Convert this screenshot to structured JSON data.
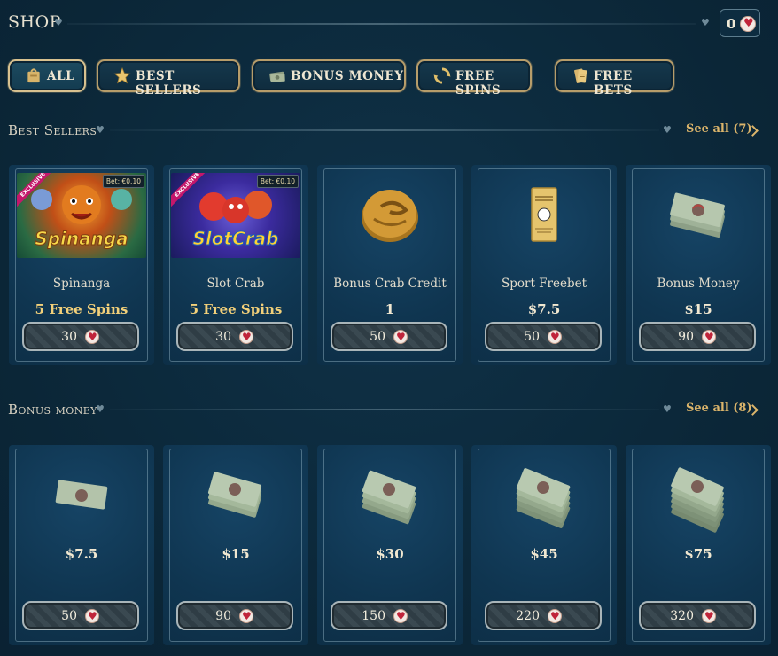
{
  "header": {
    "title": "SHOP",
    "balance": "0"
  },
  "tabs": [
    {
      "label": "ALL",
      "icon": "bag-icon",
      "active": true
    },
    {
      "label": "BEST SELLERS",
      "icon": "star-icon",
      "active": false
    },
    {
      "label": "BONUS MONEY",
      "icon": "money-icon",
      "active": false
    },
    {
      "label": "FREE SPINS",
      "icon": "spin-icon",
      "active": false
    },
    {
      "label": "FREE BETS",
      "icon": "ticket-icon",
      "active": false
    }
  ],
  "best_sellers": {
    "title": "Best Sellers",
    "see_all": "See all (7)",
    "items": [
      {
        "name": "Spinanga",
        "value": "5 Free Spins",
        "price": "30",
        "image": "Spinanga",
        "badge": "EXCLUSIVE",
        "bet": "Bet: €0.10"
      },
      {
        "name": "Slot Crab",
        "value": "5 Free Spins",
        "price": "30",
        "image": "SlotCrab",
        "badge": "EXCLUSIVE",
        "bet": "Bet: €0.10"
      },
      {
        "name": "Bonus Crab Credit",
        "value": "1",
        "price": "50",
        "image": "coin-icon"
      },
      {
        "name": "Sport Freebet",
        "value": "$7.5",
        "price": "50",
        "image": "ticket-icon"
      },
      {
        "name": "Bonus Money",
        "value": "$15",
        "price": "90",
        "image": "cash-stack-icon"
      }
    ]
  },
  "bonus_money": {
    "title": "Bonus money",
    "see_all": "See all (8)",
    "items": [
      {
        "value": "$7.5",
        "price": "50"
      },
      {
        "value": "$15",
        "price": "90"
      },
      {
        "value": "$30",
        "price": "150"
      },
      {
        "value": "$45",
        "price": "220"
      },
      {
        "value": "$75",
        "price": "320"
      }
    ]
  },
  "colors": {
    "accent_gold": "#dcb56b",
    "background": "#0c2a3e",
    "heart_red": "#c0243a"
  }
}
